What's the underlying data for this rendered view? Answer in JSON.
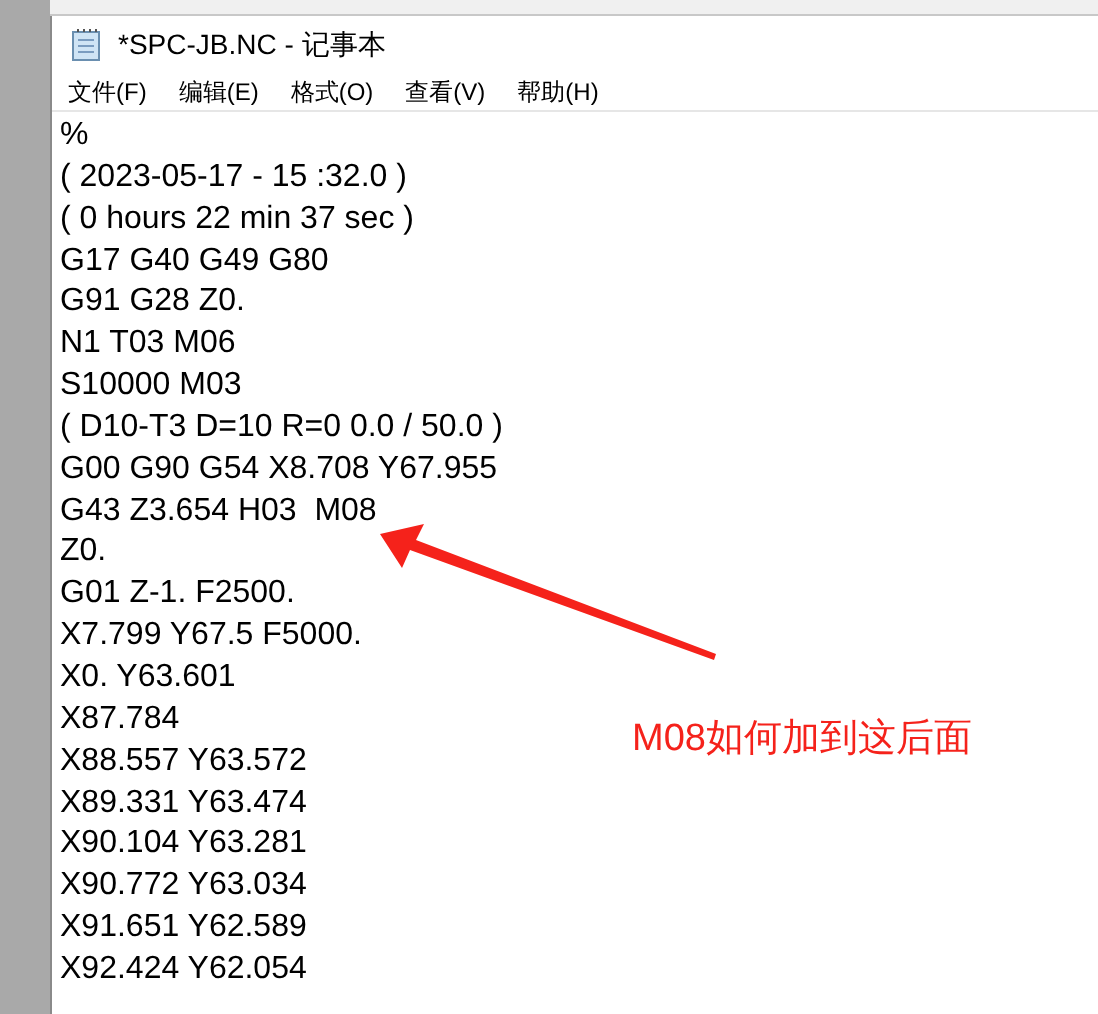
{
  "window": {
    "title": "*SPC-JB.NC - 记事本"
  },
  "menu": [
    "文件(F)",
    "编辑(E)",
    "格式(O)",
    "查看(V)",
    "帮助(H)"
  ],
  "lines": [
    "%",
    "( 2023-05-17 - 15 :32.0 )",
    "( 0 hours 22 min 37 sec )",
    "G17 G40 G49 G80",
    "G91 G28 Z0.",
    "N1 T03 M06",
    "S10000 M03",
    "( D10-T3 D=10 R=0 0.0 / 50.0 )",
    "G00 G90 G54 X8.708 Y67.955",
    "G43 Z3.654 H03  M08",
    "Z0.",
    "G01 Z-1. F2500.",
    "X7.799 Y67.5 F5000.",
    "X0. Y63.601",
    "X87.784",
    "X88.557 Y63.572",
    "X89.331 Y63.474",
    "X90.104 Y63.281",
    "X90.772 Y63.034",
    "X91.651 Y62.589",
    "X92.424 Y62.054"
  ],
  "annotation": {
    "text": "M08如何加到这后面"
  }
}
